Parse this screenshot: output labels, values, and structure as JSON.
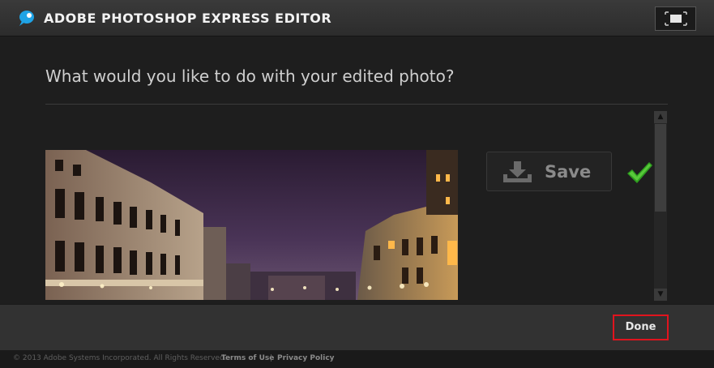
{
  "titlebar": {
    "title": "ADOBE PHOTOSHOP EXPRESS EDITOR",
    "logo_icon": "photoshop-express-bubble-icon",
    "fullscreen_icon": "fullscreen-icon"
  },
  "main": {
    "question": "What would you like to do with your edited photo?",
    "save_label": "Save",
    "save_icon": "download-tray-icon",
    "status_icon": "checkmark-icon"
  },
  "actions": {
    "done_label": "Done"
  },
  "footer": {
    "copyright": "© 2013 Adobe Systems Incorporated. All Rights Reserved.",
    "terms_label": "Terms of Use",
    "separator": "|",
    "privacy_label": "Privacy Policy"
  },
  "colors": {
    "accent_red": "#e0141e",
    "check_green": "#2e9e1f",
    "logo_blue": "#1fa3e6"
  }
}
